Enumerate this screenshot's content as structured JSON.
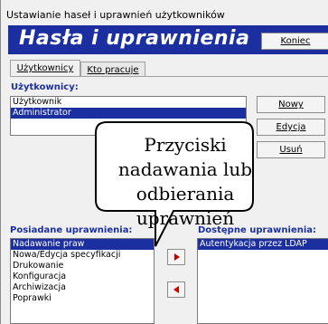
{
  "window": {
    "title": "Ustawianie haseł i uprawnień użytkowników"
  },
  "header": {
    "title": "Hasła i uprawnienia",
    "close_label": "Koniec"
  },
  "tabs": [
    {
      "label": "Użytkownicy"
    },
    {
      "label": "Kto pracuje"
    }
  ],
  "users": {
    "label": "Użytkownicy:",
    "items": [
      {
        "name": "Użytkownik",
        "selected": false
      },
      {
        "name": "Administrator",
        "selected": true
      }
    ],
    "buttons": {
      "new": "Nowy",
      "edit": "Edycja",
      "delete": "Usuń"
    }
  },
  "callout": {
    "text": "Przyciski nadawania lub odbierania uprawnień"
  },
  "owned": {
    "label": "Posiadane uprawnienia:",
    "items": [
      "Nadawanie praw",
      "Nowa/Edycja specyfikacji",
      "Drukowanie",
      "Konfiguracja",
      "Archiwizacja",
      "Poprawki"
    ],
    "selected_index": 0
  },
  "available": {
    "label": "Dostępne uprawnienia:",
    "items": [
      "Autentykacja przez LDAP"
    ],
    "selected_index": 0
  },
  "colors": {
    "accent": "#1c2fa0",
    "arrow": "#c00000"
  },
  "icons": {
    "grant": "arrow-right-icon",
    "revoke": "arrow-left-icon"
  }
}
